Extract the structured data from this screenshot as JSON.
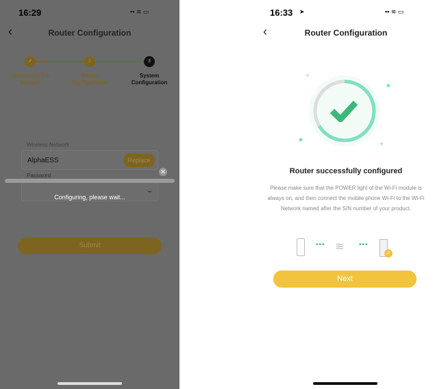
{
  "left": {
    "status": {
      "time": "16:29"
    },
    "header": {
      "title": "Router Configuration"
    },
    "steps": [
      {
        "num": "1",
        "label1": "Connect to the",
        "label2": "hotspot",
        "state": "done"
      },
      {
        "num": "2",
        "label1": "Router",
        "label2": "Configuration",
        "state": "done"
      },
      {
        "num": "3",
        "label1": "System",
        "label2": "Configuration",
        "state": "current"
      }
    ],
    "form": {
      "network_label": "Wireless Network",
      "network_value": "AlphaESS",
      "replace_label": "Replace",
      "password_label": "Password"
    },
    "toast": {
      "message": "Configuring, please wait..."
    },
    "submit_label": "Submit"
  },
  "right": {
    "status": {
      "time": "16:33"
    },
    "header": {
      "title": "Router Configuration"
    },
    "heading": "Router successfully configured",
    "description": "Please make sure that the POWER light of the Wi-Fi module is always on, and then connect the mobile phone Wi-Fi to the Wi-Fi Network named after the S/N number of your product.",
    "next_label": "Next"
  },
  "colors": {
    "accent": "#f2c43d",
    "success": "#3cb97a",
    "ring": "#7fe0c0"
  }
}
